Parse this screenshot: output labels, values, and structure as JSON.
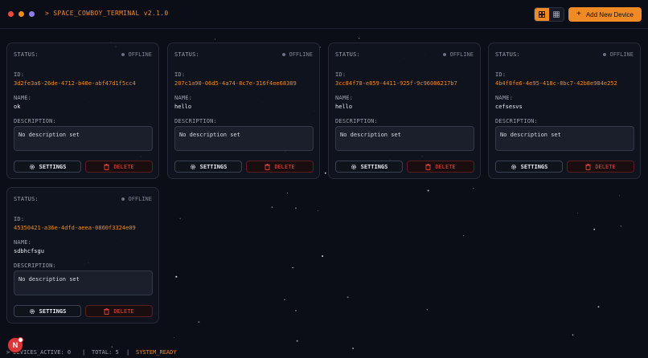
{
  "header": {
    "title": "> SPACE_COWBOY_TERMINAL v2.1.0",
    "add_button_label": "Add New Device",
    "view_mode": "grid-large",
    "accent_color": "#f08a24"
  },
  "labels": {
    "status": "STATUS:",
    "id": "ID:",
    "name": "NAME:",
    "description": "DESCRIPTION:",
    "settings": "SETTINGS",
    "delete": "DELETE"
  },
  "devices": [
    {
      "status": "OFFLINE",
      "id": "3d2fe3a6-26de-4712-b40e-abf47d1f5cc4",
      "name": "ok",
      "description": "No description set"
    },
    {
      "status": "OFFLINE",
      "id": "207c1a90-06d5-4a74-8c7e-316f4ee68389",
      "name": "hello",
      "description": "No description set"
    },
    {
      "status": "OFFLINE",
      "id": "3cc84f78-e859-4411-925f-9c96086217b7",
      "name": "hello",
      "description": "No description set"
    },
    {
      "status": "OFFLINE",
      "id": "4b4f8fe6-4e95-418c-8bc7-42b8e984e252",
      "name": "cefsesvs",
      "description": "No description set"
    },
    {
      "status": "OFFLINE",
      "id": "45350421-a36e-4dfd-aeea-0860f3324e09",
      "name": "sdbhcfsgu",
      "description": "No description set"
    }
  ],
  "footer": {
    "devices_active": "> DEVICES_ACTIVE: 0",
    "separator": "|",
    "total": "TOTAL: 5",
    "system_status": "SYSTEM_READY"
  },
  "badge": {
    "letter": "N"
  }
}
